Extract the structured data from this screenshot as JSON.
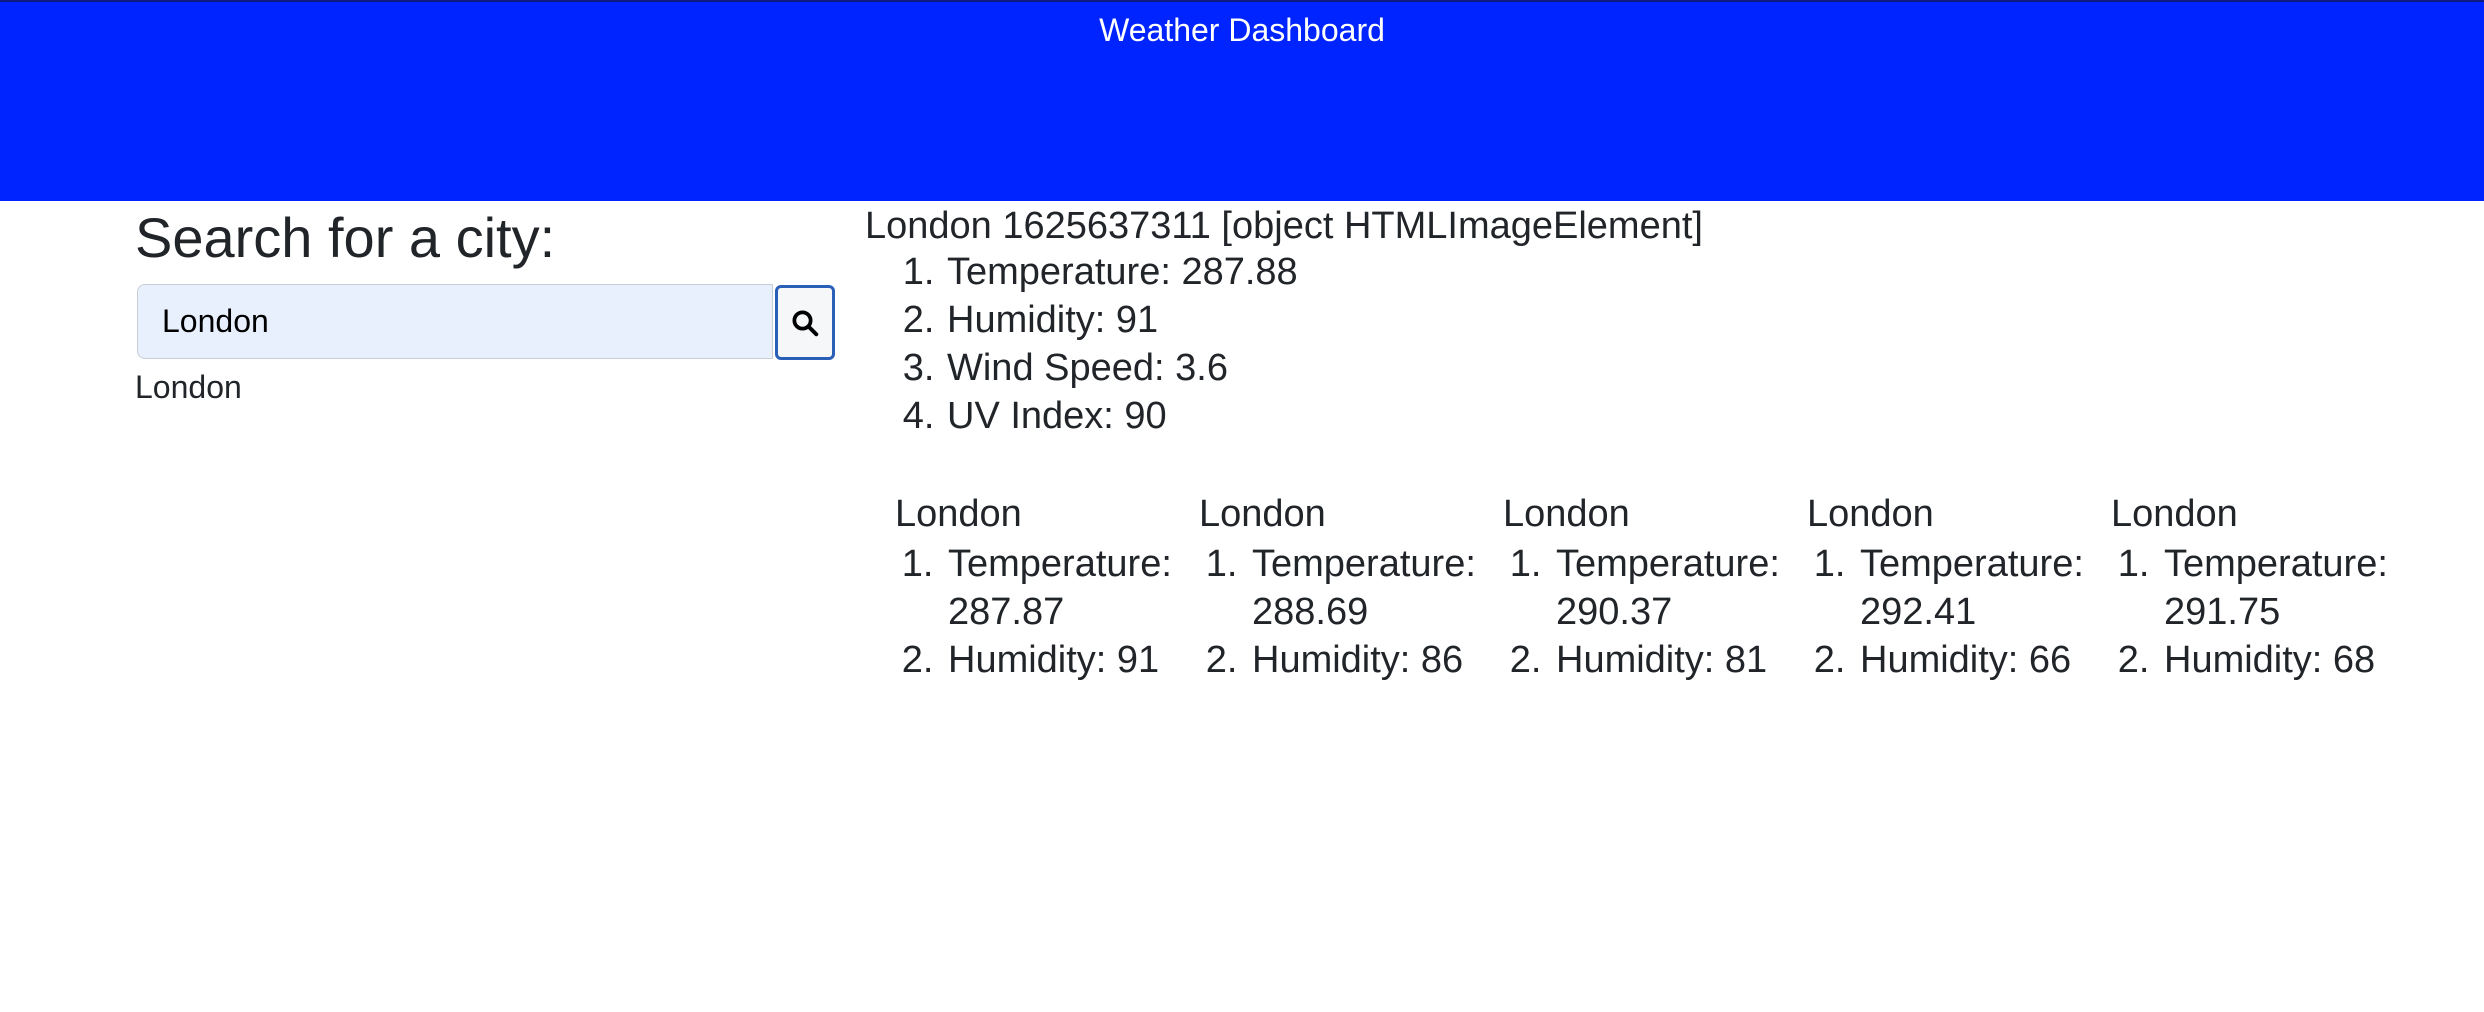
{
  "header": {
    "title": "Weather Dashboard"
  },
  "search": {
    "heading": "Search for a city:",
    "value": "London",
    "history": [
      "London"
    ]
  },
  "current": {
    "title": "London 1625637311 [object HTMLImageElement]",
    "temperature": "Temperature: 287.88",
    "humidity": "Humidity: 91",
    "wind_speed": "Wind Speed: 3.6",
    "uv_index": "UV Index: 90"
  },
  "forecast": [
    {
      "city": "London",
      "temperature": "Temperature: 287.87",
      "humidity": "Humidity: 91"
    },
    {
      "city": "London",
      "temperature": "Temperature: 288.69",
      "humidity": "Humidity: 86"
    },
    {
      "city": "London",
      "temperature": "Temperature: 290.37",
      "humidity": "Humidity: 81"
    },
    {
      "city": "London",
      "temperature": "Temperature: 292.41",
      "humidity": "Humidity: 66"
    },
    {
      "city": "London",
      "temperature": "Temperature: 291.75",
      "humidity": "Humidity: 68"
    }
  ],
  "icons": {
    "search_button": "search-icon"
  },
  "colors": {
    "header_bg": "#0024ff",
    "input_bg": "#e8f0fe",
    "button_border": "#2a5fb8"
  }
}
